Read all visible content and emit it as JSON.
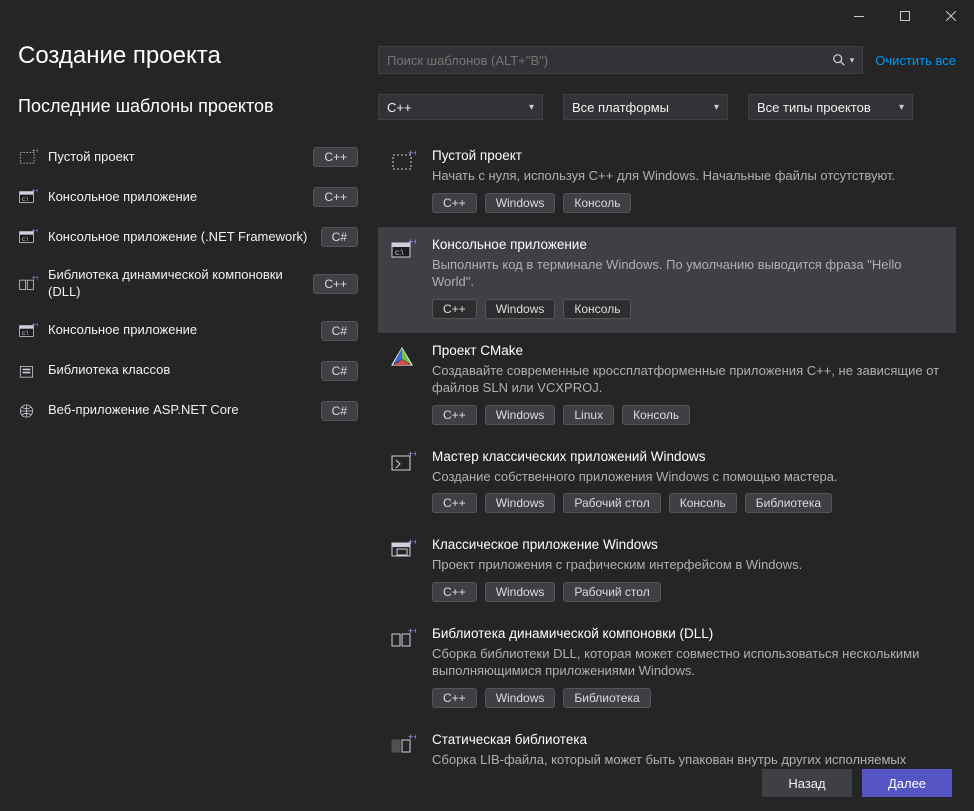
{
  "window": {
    "title": "Создание проекта",
    "recent_heading": "Последние шаблоны проектов"
  },
  "search": {
    "placeholder": "Поиск шаблонов (ALT+\"B\")",
    "clear_label": "Очистить все"
  },
  "filters": {
    "language": "C++",
    "platform": "Все платформы",
    "project_type": "Все типы проектов"
  },
  "recent": [
    {
      "label": "Пустой проект",
      "lang": "C++",
      "icon": "empty-project-icon"
    },
    {
      "label": "Консольное приложение",
      "lang": "C++",
      "icon": "console-icon"
    },
    {
      "label": "Консольное приложение (.NET Framework)",
      "lang": "C#",
      "icon": "console-icon"
    },
    {
      "label": "Библиотека динамической компоновки (DLL)",
      "lang": "C++",
      "icon": "dll-icon"
    },
    {
      "label": "Консольное приложение",
      "lang": "C#",
      "icon": "console-icon"
    },
    {
      "label": "Библиотека классов",
      "lang": "C#",
      "icon": "classlib-icon"
    },
    {
      "label": "Веб-приложение ASP.NET Core",
      "lang": "C#",
      "icon": "web-icon"
    }
  ],
  "templates": [
    {
      "title": "Пустой проект",
      "desc": "Начать с нуля, используя C++ для Windows. Начальные файлы отсутствуют.",
      "tags": [
        "C++",
        "Windows",
        "Консоль"
      ],
      "selected": false,
      "icon": "empty-project-icon"
    },
    {
      "title": "Консольное приложение",
      "desc": "Выполнить код в терминале Windows. По умолчанию выводится фраза \"Hello World\".",
      "tags": [
        "C++",
        "Windows",
        "Консоль"
      ],
      "selected": true,
      "icon": "console-icon"
    },
    {
      "title": "Проект CMake",
      "desc": "Создавайте современные кроссплатформенные приложения C++, не зависящие от файлов SLN или VCXPROJ.",
      "tags": [
        "C++",
        "Windows",
        "Linux",
        "Консоль"
      ],
      "selected": false,
      "icon": "cmake-icon"
    },
    {
      "title": "Мастер классических приложений Windows",
      "desc": "Создание собственного приложения Windows с помощью мастера.",
      "tags": [
        "C++",
        "Windows",
        "Рабочий стол",
        "Консоль",
        "Библиотека"
      ],
      "selected": false,
      "icon": "wizard-icon"
    },
    {
      "title": "Классическое приложение Windows",
      "desc": "Проект приложения с графическим интерфейсом в Windows.",
      "tags": [
        "C++",
        "Windows",
        "Рабочий стол"
      ],
      "selected": false,
      "icon": "desktop-app-icon"
    },
    {
      "title": "Библиотека динамической компоновки (DLL)",
      "desc": "Сборка библиотеки DLL, которая может совместно использоваться несколькими выполняющимися приложениями Windows.",
      "tags": [
        "C++",
        "Windows",
        "Библиотека"
      ],
      "selected": false,
      "icon": "dll-icon"
    },
    {
      "title": "Статическая библиотека",
      "desc": "Сборка LIB-файла, который может быть упакован внутрь других исполняемых файлов Windows.",
      "tags": [],
      "selected": false,
      "icon": "staticlib-icon"
    }
  ],
  "footer": {
    "back": "Назад",
    "next": "Далее"
  }
}
